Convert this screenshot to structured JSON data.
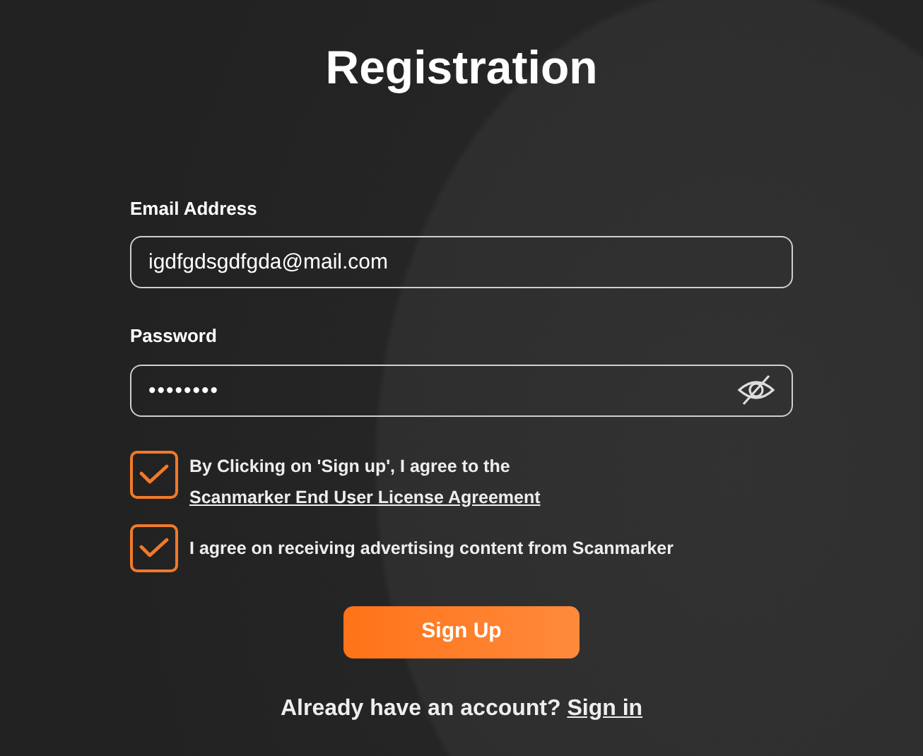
{
  "title": "Registration",
  "fields": [
    {
      "label": "Email Address",
      "value": "igdfgdsgdfgda@mail.com",
      "kind": "text"
    },
    {
      "label": "Password",
      "value": "••••••••",
      "kind": "password",
      "revealed": false
    }
  ],
  "agreements": [
    {
      "checked": true,
      "parts": [
        {
          "kind": "text",
          "text": "By Clicking on 'Sign up', I agree to the "
        },
        {
          "kind": "link",
          "text": "Scanmarker End User License Agreement"
        }
      ]
    },
    {
      "checked": true,
      "parts": [
        {
          "kind": "text",
          "text": "I agree on receiving advertising content from Scanmarker"
        }
      ]
    }
  ],
  "submit": "Sign Up",
  "footer": {
    "text": "Already have an account?",
    "link": "Sign in"
  }
}
